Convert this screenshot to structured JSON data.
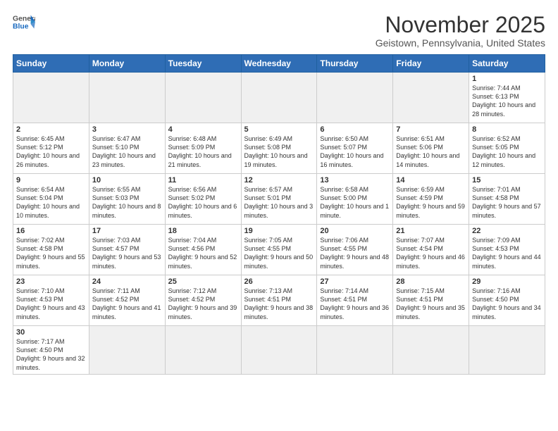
{
  "header": {
    "logo_line1": "General",
    "logo_line2": "Blue",
    "title": "November 2025",
    "subtitle": "Geistown, Pennsylvania, United States"
  },
  "weekdays": [
    "Sunday",
    "Monday",
    "Tuesday",
    "Wednesday",
    "Thursday",
    "Friday",
    "Saturday"
  ],
  "weeks": [
    [
      {
        "day": "",
        "info": ""
      },
      {
        "day": "",
        "info": ""
      },
      {
        "day": "",
        "info": ""
      },
      {
        "day": "",
        "info": ""
      },
      {
        "day": "",
        "info": ""
      },
      {
        "day": "",
        "info": ""
      },
      {
        "day": "1",
        "info": "Sunrise: 7:44 AM\nSunset: 6:13 PM\nDaylight: 10 hours\nand 28 minutes."
      }
    ],
    [
      {
        "day": "2",
        "info": "Sunrise: 6:45 AM\nSunset: 5:12 PM\nDaylight: 10 hours\nand 26 minutes."
      },
      {
        "day": "3",
        "info": "Sunrise: 6:47 AM\nSunset: 5:10 PM\nDaylight: 10 hours\nand 23 minutes."
      },
      {
        "day": "4",
        "info": "Sunrise: 6:48 AM\nSunset: 5:09 PM\nDaylight: 10 hours\nand 21 minutes."
      },
      {
        "day": "5",
        "info": "Sunrise: 6:49 AM\nSunset: 5:08 PM\nDaylight: 10 hours\nand 19 minutes."
      },
      {
        "day": "6",
        "info": "Sunrise: 6:50 AM\nSunset: 5:07 PM\nDaylight: 10 hours\nand 16 minutes."
      },
      {
        "day": "7",
        "info": "Sunrise: 6:51 AM\nSunset: 5:06 PM\nDaylight: 10 hours\nand 14 minutes."
      },
      {
        "day": "8",
        "info": "Sunrise: 6:52 AM\nSunset: 5:05 PM\nDaylight: 10 hours\nand 12 minutes."
      }
    ],
    [
      {
        "day": "9",
        "info": "Sunrise: 6:54 AM\nSunset: 5:04 PM\nDaylight: 10 hours\nand 10 minutes."
      },
      {
        "day": "10",
        "info": "Sunrise: 6:55 AM\nSunset: 5:03 PM\nDaylight: 10 hours\nand 8 minutes."
      },
      {
        "day": "11",
        "info": "Sunrise: 6:56 AM\nSunset: 5:02 PM\nDaylight: 10 hours\nand 6 minutes."
      },
      {
        "day": "12",
        "info": "Sunrise: 6:57 AM\nSunset: 5:01 PM\nDaylight: 10 hours\nand 3 minutes."
      },
      {
        "day": "13",
        "info": "Sunrise: 6:58 AM\nSunset: 5:00 PM\nDaylight: 10 hours\nand 1 minute."
      },
      {
        "day": "14",
        "info": "Sunrise: 6:59 AM\nSunset: 4:59 PM\nDaylight: 9 hours\nand 59 minutes."
      },
      {
        "day": "15",
        "info": "Sunrise: 7:01 AM\nSunset: 4:58 PM\nDaylight: 9 hours\nand 57 minutes."
      }
    ],
    [
      {
        "day": "16",
        "info": "Sunrise: 7:02 AM\nSunset: 4:58 PM\nDaylight: 9 hours\nand 55 minutes."
      },
      {
        "day": "17",
        "info": "Sunrise: 7:03 AM\nSunset: 4:57 PM\nDaylight: 9 hours\nand 53 minutes."
      },
      {
        "day": "18",
        "info": "Sunrise: 7:04 AM\nSunset: 4:56 PM\nDaylight: 9 hours\nand 52 minutes."
      },
      {
        "day": "19",
        "info": "Sunrise: 7:05 AM\nSunset: 4:55 PM\nDaylight: 9 hours\nand 50 minutes."
      },
      {
        "day": "20",
        "info": "Sunrise: 7:06 AM\nSunset: 4:55 PM\nDaylight: 9 hours\nand 48 minutes."
      },
      {
        "day": "21",
        "info": "Sunrise: 7:07 AM\nSunset: 4:54 PM\nDaylight: 9 hours\nand 46 minutes."
      },
      {
        "day": "22",
        "info": "Sunrise: 7:09 AM\nSunset: 4:53 PM\nDaylight: 9 hours\nand 44 minutes."
      }
    ],
    [
      {
        "day": "23",
        "info": "Sunrise: 7:10 AM\nSunset: 4:53 PM\nDaylight: 9 hours\nand 43 minutes."
      },
      {
        "day": "24",
        "info": "Sunrise: 7:11 AM\nSunset: 4:52 PM\nDaylight: 9 hours\nand 41 minutes."
      },
      {
        "day": "25",
        "info": "Sunrise: 7:12 AM\nSunset: 4:52 PM\nDaylight: 9 hours\nand 39 minutes."
      },
      {
        "day": "26",
        "info": "Sunrise: 7:13 AM\nSunset: 4:51 PM\nDaylight: 9 hours\nand 38 minutes."
      },
      {
        "day": "27",
        "info": "Sunrise: 7:14 AM\nSunset: 4:51 PM\nDaylight: 9 hours\nand 36 minutes."
      },
      {
        "day": "28",
        "info": "Sunrise: 7:15 AM\nSunset: 4:51 PM\nDaylight: 9 hours\nand 35 minutes."
      },
      {
        "day": "29",
        "info": "Sunrise: 7:16 AM\nSunset: 4:50 PM\nDaylight: 9 hours\nand 34 minutes."
      }
    ],
    [
      {
        "day": "30",
        "info": "Sunrise: 7:17 AM\nSunset: 4:50 PM\nDaylight: 9 hours\nand 32 minutes."
      },
      {
        "day": "",
        "info": ""
      },
      {
        "day": "",
        "info": ""
      },
      {
        "day": "",
        "info": ""
      },
      {
        "day": "",
        "info": ""
      },
      {
        "day": "",
        "info": ""
      },
      {
        "day": "",
        "info": ""
      }
    ]
  ]
}
